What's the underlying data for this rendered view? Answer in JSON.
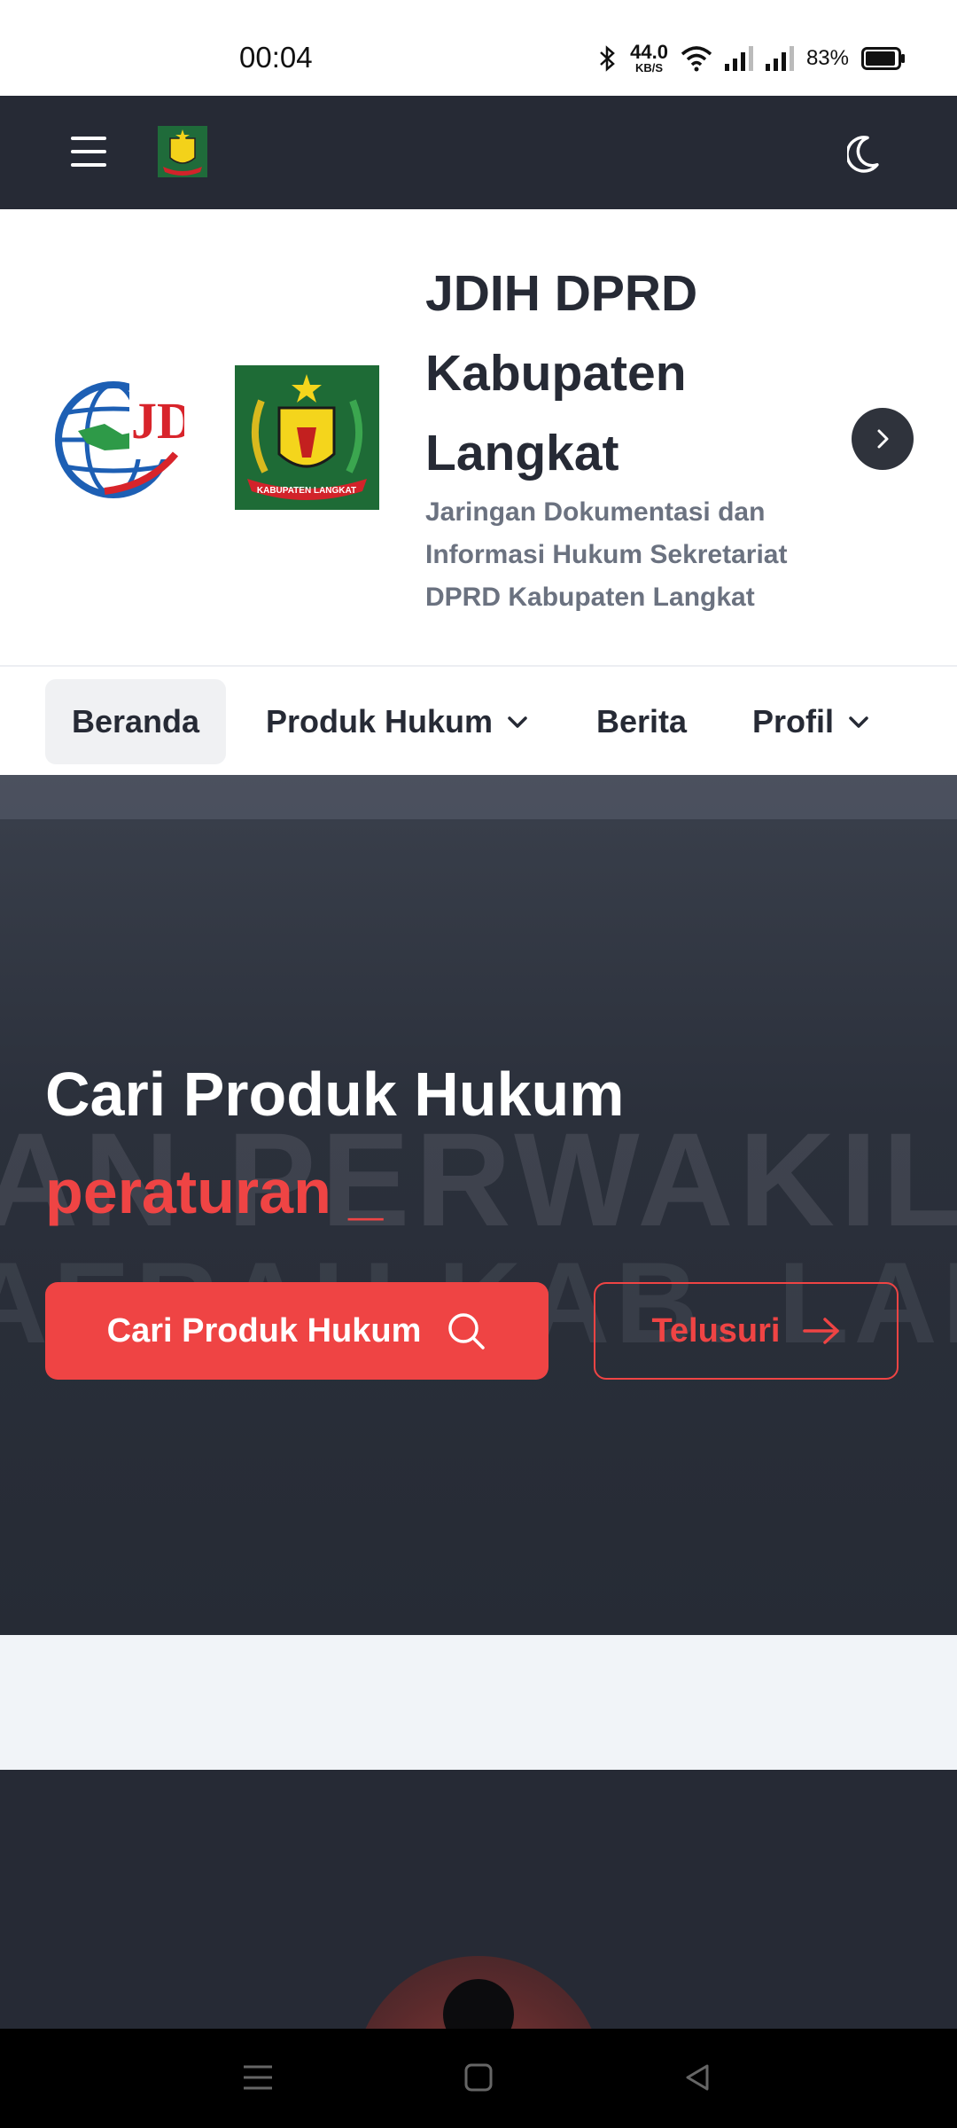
{
  "status_bar": {
    "time": "00:04",
    "net_speed_value": "44.0",
    "net_speed_unit": "KB/S",
    "battery": "83%",
    "icons": [
      "bluetooth-icon",
      "wifi-icon",
      "signal-icon",
      "signal-icon",
      "battery-icon"
    ]
  },
  "app_bar": {
    "menu_icon": "hamburger-icon",
    "logo": "kabupaten-langkat-emblem",
    "theme_icon": "moon-icon",
    "background": "#262a35"
  },
  "brand": {
    "logo_jdih_text": "JDIHN",
    "logo_kabupaten_text": "KABUPATEN LANGKAT",
    "title": "JDIH DPRD Kabupaten Langkat",
    "subtitle": "Jaringan Dokumentasi dan Informasi Hukum Sekretariat DPRD Kabupaten Langkat",
    "next_icon": "chevron-right-icon"
  },
  "nav": {
    "items": [
      {
        "label": "Beranda",
        "active": true
      },
      {
        "label": "Produk Hukum",
        "dropdown": true
      },
      {
        "label": "Berita"
      },
      {
        "label": "Profil",
        "dropdown": true
      }
    ]
  },
  "hero": {
    "title": "Cari Produk Hukum",
    "typed_text": "peraturan _",
    "primary_button": "Cari Produk Hukum",
    "primary_icon": "search-icon",
    "secondary_button": "Telusuri",
    "secondary_icon": "arrow-right-icon",
    "background_text_1": "AN PERWAKILAN RA",
    "background_text_2": "AERAH KAB. LANGK",
    "accent_color": "#ef4444"
  },
  "system_nav": {
    "icons": [
      "recent-apps-icon",
      "home-icon",
      "back-icon"
    ]
  }
}
